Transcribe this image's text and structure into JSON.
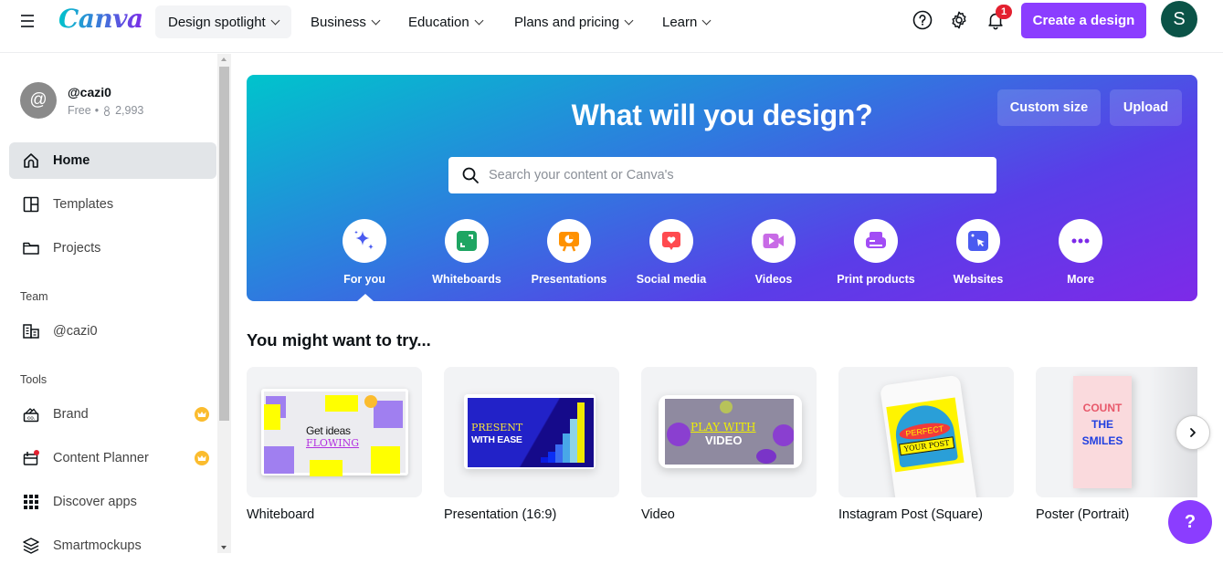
{
  "header": {
    "logo": "Canva",
    "nav": [
      {
        "label": "Design spotlight",
        "active": true
      },
      {
        "label": "Business"
      },
      {
        "label": "Education"
      },
      {
        "label": "Plans and pricing"
      },
      {
        "label": "Learn"
      }
    ],
    "notification_count": "1",
    "create_label": "Create a design",
    "avatar_initial": "S",
    "accent": "#8b3dff"
  },
  "sidebar": {
    "user": {
      "avatar_glyph": "@",
      "name": "@cazi0",
      "plan": "Free",
      "followers": "2,993"
    },
    "items": [
      {
        "label": "Home",
        "icon": "home-icon"
      },
      {
        "label": "Templates",
        "icon": "templates-icon"
      },
      {
        "label": "Projects",
        "icon": "folder-icon"
      }
    ],
    "team_label": "Team",
    "team_items": [
      {
        "label": "@cazi0",
        "icon": "building-icon"
      }
    ],
    "tools_label": "Tools",
    "tools_items": [
      {
        "label": "Brand",
        "icon": "brand-kit-icon",
        "premium": true
      },
      {
        "label": "Content Planner",
        "icon": "calendar-icon",
        "premium": true
      },
      {
        "label": "Discover apps",
        "icon": "apps-grid-icon"
      },
      {
        "label": "Smartmockups",
        "icon": "layers-icon"
      }
    ]
  },
  "hero": {
    "title": "What will you design?",
    "custom_size_label": "Custom size",
    "upload_label": "Upload",
    "search_placeholder": "Search your content or Canva's",
    "categories": [
      {
        "label": "For you",
        "icon": "sparkle-icon",
        "color": "#4a5bf0"
      },
      {
        "label": "Whiteboards",
        "icon": "whiteboard-icon",
        "color": "#1ea562"
      },
      {
        "label": "Presentations",
        "icon": "presentation-icon",
        "color": "#ff9100"
      },
      {
        "label": "Social media",
        "icon": "social-heart-icon",
        "color": "#ff4a4f"
      },
      {
        "label": "Videos",
        "icon": "video-camera-icon",
        "color": "#c86be6"
      },
      {
        "label": "Print products",
        "icon": "printer-icon",
        "color": "#a24cf5"
      },
      {
        "label": "Websites",
        "icon": "website-cursor-icon",
        "color": "#4a5bf0"
      },
      {
        "label": "More",
        "icon": "more-dots-icon",
        "color": "#7d2ae8"
      }
    ]
  },
  "suggestions": {
    "title": "You might want to try...",
    "cards": [
      {
        "label": "Whiteboard",
        "thumb_text": [
          "Get ideas",
          "FLOWING"
        ]
      },
      {
        "label": "Presentation (16:9)",
        "thumb_text": [
          "PRESENT",
          "WITH EASE"
        ]
      },
      {
        "label": "Video",
        "thumb_text": [
          "PLAY WITH",
          "VIDEO"
        ]
      },
      {
        "label": "Instagram Post (Square)",
        "thumb_text": [
          "PERFECT",
          "YOUR POST"
        ]
      },
      {
        "label": "Poster (Portrait)",
        "thumb_text": [
          "COUNT",
          "THE",
          "SMILES"
        ]
      }
    ]
  },
  "help_label": "?"
}
